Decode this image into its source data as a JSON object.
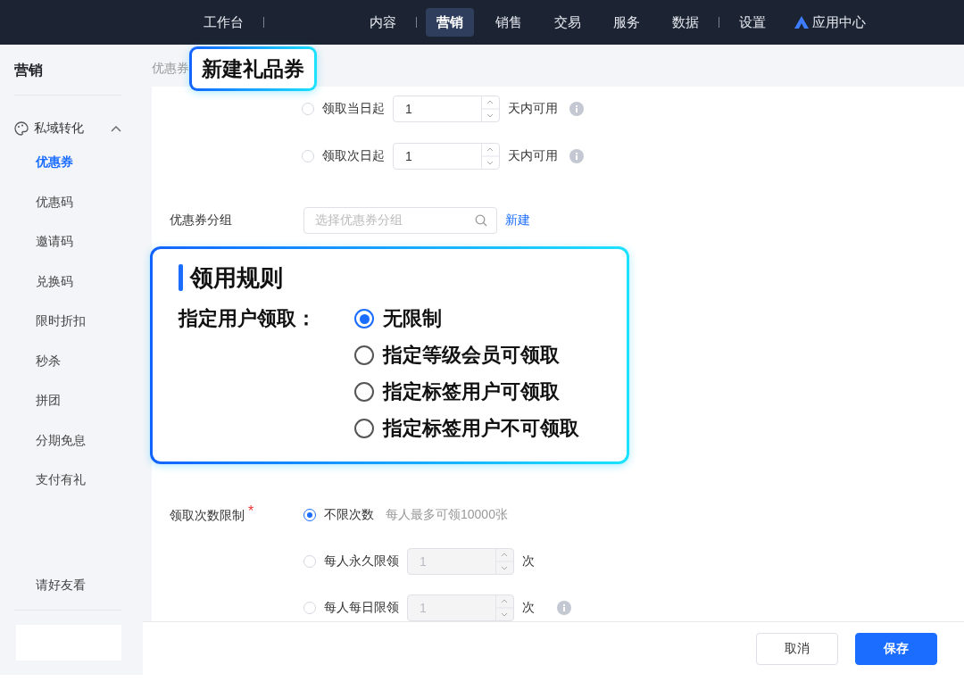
{
  "top_nav": {
    "items": [
      {
        "label": "工作台",
        "selected": false,
        "separator": true
      },
      {
        "label": "内容",
        "selected": false,
        "separator": true
      },
      {
        "label": "营销",
        "selected": true,
        "separator": false
      },
      {
        "label": "销售",
        "selected": false,
        "separator": false
      },
      {
        "label": "交易",
        "selected": false,
        "separator": false
      },
      {
        "label": "服务",
        "selected": false,
        "separator": false
      },
      {
        "label": "数据",
        "selected": false,
        "separator": true
      },
      {
        "label": "设置",
        "selected": false,
        "separator": false
      }
    ],
    "app_center": "应用中心"
  },
  "sidebar": {
    "title": "营销",
    "group": {
      "label": "私域转化",
      "expanded": true,
      "children": [
        {
          "label": "优惠券",
          "selected": true
        },
        {
          "label": "优惠码",
          "selected": false
        },
        {
          "label": "邀请码",
          "selected": false
        },
        {
          "label": "兑换码",
          "selected": false
        },
        {
          "label": "限时折扣",
          "selected": false
        },
        {
          "label": "秒杀",
          "selected": false
        },
        {
          "label": "拼团",
          "selected": false
        },
        {
          "label": "分期免息",
          "selected": false
        },
        {
          "label": "支付有礼",
          "selected": false
        }
      ]
    },
    "extra_items": [
      {
        "label": "请好友看",
        "selected": false
      }
    ]
  },
  "breadcrumb": "优惠券",
  "form": {
    "validity_options": [
      {
        "label": "领取当日起",
        "selected": false,
        "value": "1",
        "suffix": "天内可用",
        "info": true
      },
      {
        "label": "领取次日起",
        "selected": false,
        "value": "1",
        "suffix": "天内可用",
        "info": true
      }
    ],
    "group_field": {
      "label": "优惠券分组",
      "placeholder": "选择优惠券分组",
      "link": "新建"
    },
    "limit_field": {
      "label": "领取次数限制",
      "required_mark": "*",
      "options": [
        {
          "kind": "note",
          "label": "不限次数",
          "selected": true,
          "note": "每人最多可领10000张"
        },
        {
          "kind": "input",
          "label": "每人永久限领",
          "selected": false,
          "value": "1",
          "suffix": "次",
          "disabled": true,
          "info": false
        },
        {
          "kind": "input",
          "label": "每人每日限领",
          "selected": false,
          "value": "1",
          "suffix": "次",
          "disabled": true,
          "info": true
        }
      ]
    }
  },
  "footer": {
    "buttons": [
      {
        "label": "取消",
        "kind": "secondary"
      },
      {
        "label": "保存",
        "kind": "primary"
      }
    ]
  },
  "callouts": [
    {
      "kind": "title",
      "text": "新建礼品券"
    },
    {
      "kind": "panel",
      "heading": "领用规则",
      "field_label": "指定用户领取：",
      "options": [
        {
          "label": "无限制",
          "selected": true
        },
        {
          "label": "指定等级会员可领取",
          "selected": false
        },
        {
          "label": "指定标签用户可领取",
          "selected": false
        },
        {
          "label": "指定标签用户不可领取",
          "selected": false
        }
      ]
    }
  ]
}
